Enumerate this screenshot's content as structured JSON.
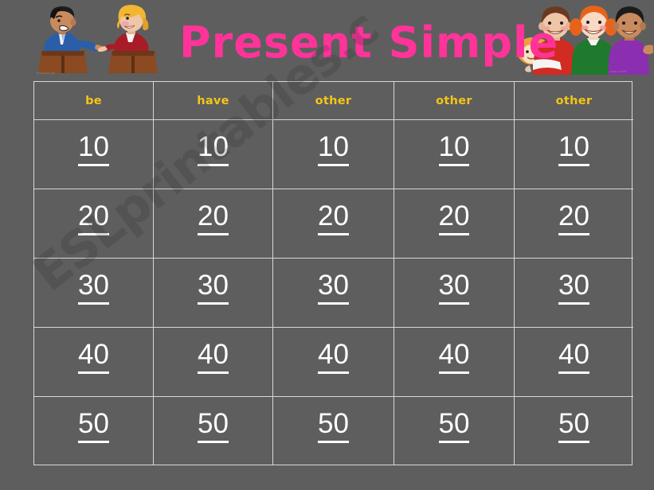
{
  "slide": {
    "title": "Present Simple",
    "background_color": "#5e5e5e",
    "title_color": "#ff3399",
    "header_text_color": "#f5c518",
    "value_text_color": "#ffffff",
    "grid_line_color": "#d8d8d8"
  },
  "watermark": {
    "text": "ESLprintables.c"
  },
  "clipart": {
    "left": {
      "name": "two-people-at-podiums-debating",
      "credit": "Microsoft clip",
      "figures": [
        {
          "name": "man-speaker",
          "suit_color": "#2a5ea8",
          "hair_color": "#1c1c1c",
          "skin_color": "#c98a5e"
        },
        {
          "name": "woman-speaker",
          "suit_color": "#a81c28",
          "hair_color": "#f2b632",
          "skin_color": "#f0c6a8"
        }
      ],
      "podium_color": "#8b4a22"
    },
    "right": {
      "name": "three-smiling-children",
      "credit": "clipart credit",
      "figures": [
        {
          "name": "boy-red-shirt",
          "shirt_color": "#d12b22",
          "hair_color": "#6b3a1e",
          "skin_color": "#f0c6a8"
        },
        {
          "name": "girl-green-shirt",
          "shirt_color": "#1f7a2e",
          "hair_color": "#e8631a",
          "skin_color": "#f7d9c4"
        },
        {
          "name": "boy-purple-shirt",
          "shirt_color": "#8b2fb0",
          "hair_color": "#1c1c1c",
          "skin_color": "#c98a5e"
        }
      ]
    }
  },
  "board": {
    "columns": [
      {
        "label": "be"
      },
      {
        "label": "have"
      },
      {
        "label": "other"
      },
      {
        "label": "other"
      },
      {
        "label": "other"
      }
    ],
    "rows": [
      {
        "values": [
          "10",
          "10",
          "10",
          "10",
          "10"
        ]
      },
      {
        "values": [
          "20",
          "20",
          "20",
          "20",
          "20"
        ]
      },
      {
        "values": [
          "30",
          "30",
          "30",
          "30",
          "30"
        ]
      },
      {
        "values": [
          "40",
          "40",
          "40",
          "40",
          "40"
        ]
      },
      {
        "values": [
          "50",
          "50",
          "50",
          "50",
          "50"
        ]
      }
    ]
  }
}
